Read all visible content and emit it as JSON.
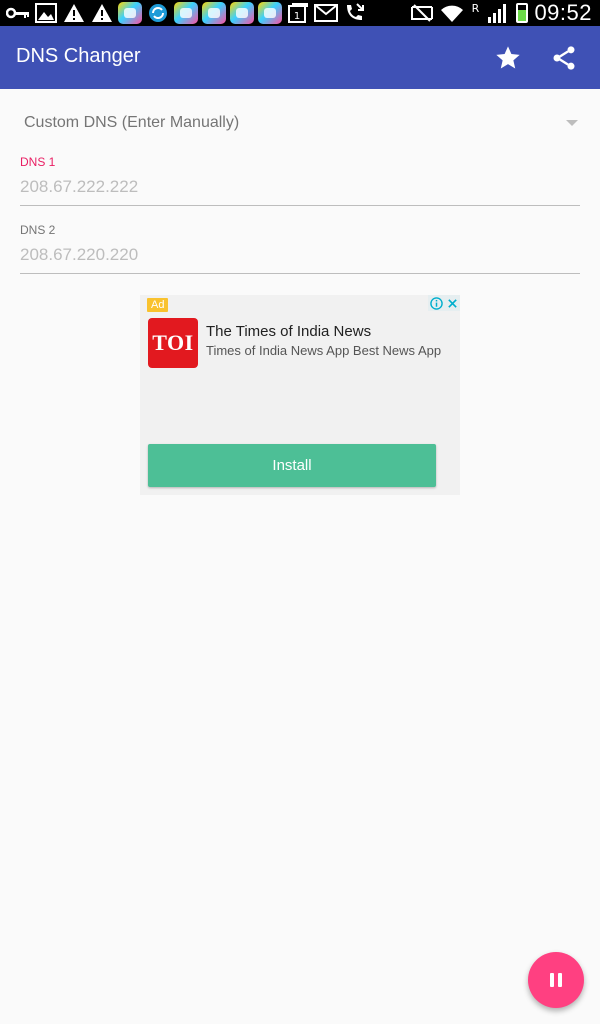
{
  "status_bar": {
    "time": "09:52",
    "left_icons": [
      "key-icon",
      "image-icon",
      "warning-icon",
      "warning-icon",
      "app-icon",
      "sync-icon",
      "app-icon",
      "app-icon",
      "app-icon",
      "app-icon",
      "calendar-icon",
      "mail-icon",
      "call-forward-icon"
    ],
    "right_icons": [
      "mute-icon",
      "wifi-icon",
      "roaming-icon",
      "signal-icon",
      "battery-icon"
    ],
    "roaming_label": "R",
    "calendar_day": "1"
  },
  "app_bar": {
    "title": "DNS Changer",
    "background": "#3f51b5",
    "actions": [
      "star-icon",
      "share-icon"
    ]
  },
  "dns_spinner": {
    "selected": "Custom DNS (Enter Manually)"
  },
  "dns1": {
    "label": "DNS 1",
    "placeholder": "208.67.222.222",
    "label_color": "#e91e63"
  },
  "dns2": {
    "label": "DNS 2",
    "placeholder": "208.67.220.220"
  },
  "ad": {
    "badge": "Ad",
    "logo_text": "TOI",
    "title": "The Times of India News",
    "description": "Times of India News App Best News App",
    "cta": "Install",
    "cta_color": "#4dbf96",
    "logo_color": "#e2191f"
  },
  "fab": {
    "icon": "pause-icon",
    "color": "#ff4081"
  }
}
